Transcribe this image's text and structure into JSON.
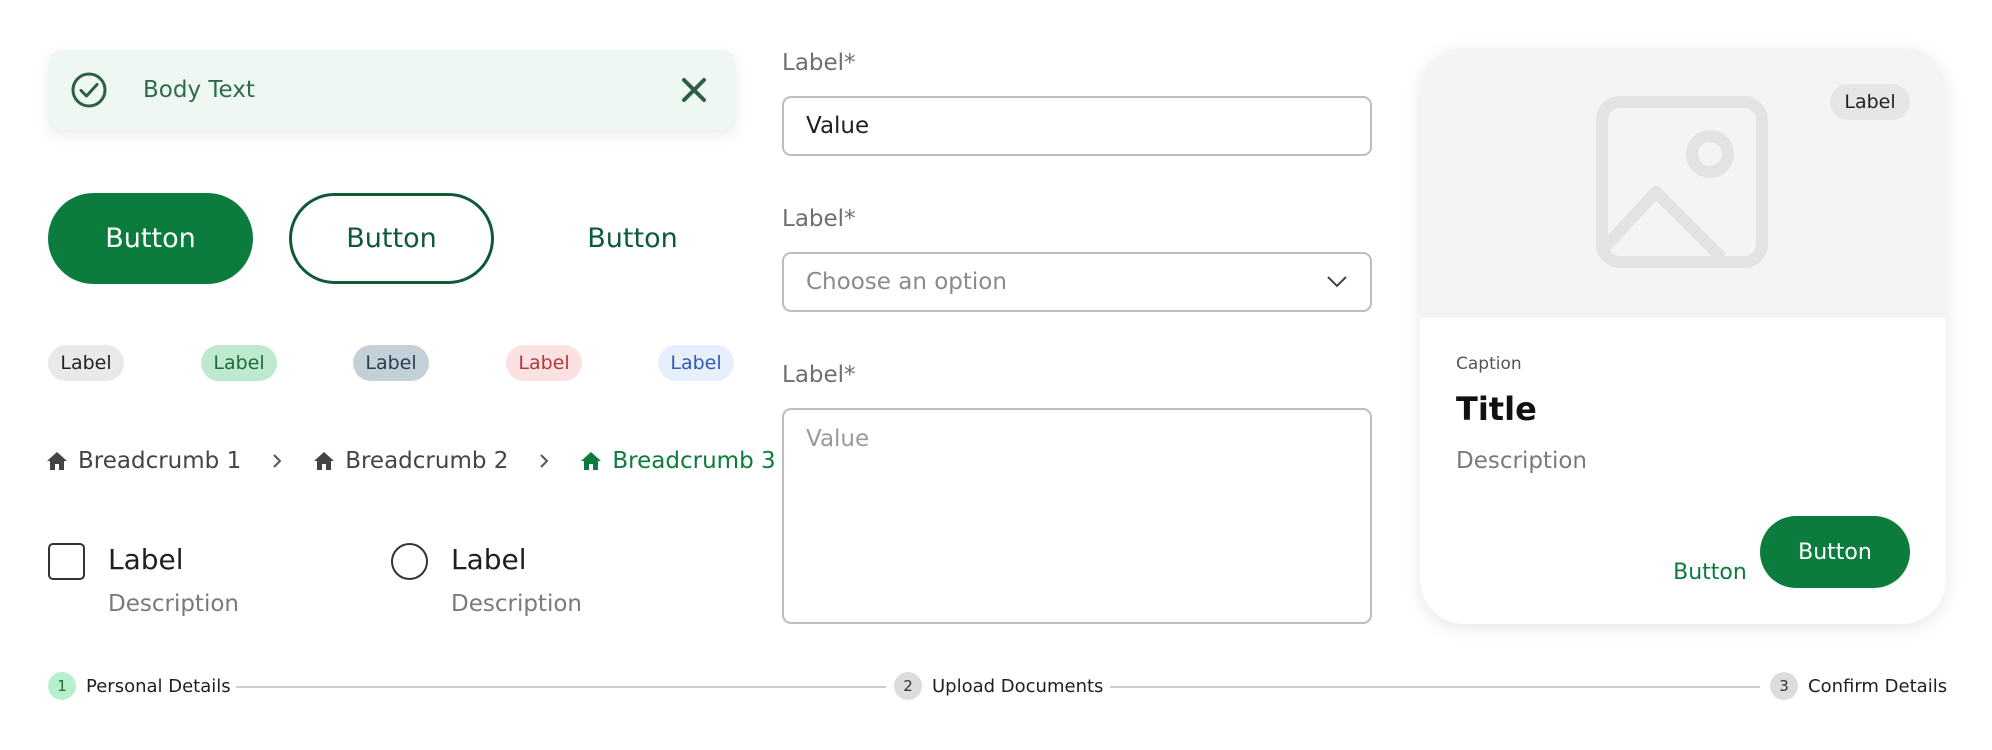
{
  "toast": {
    "text": "Body Text"
  },
  "buttons": {
    "primary": "Button",
    "outline": "Button",
    "text": "Button"
  },
  "tags": [
    "Label",
    "Label",
    "Label",
    "Label",
    "Label"
  ],
  "breadcrumbs": [
    "Breadcrumb 1",
    "Breadcrumb 2",
    "Breadcrumb 3"
  ],
  "checkbox": {
    "label": "Label",
    "description": "Description"
  },
  "radio": {
    "label": "Label",
    "description": "Description"
  },
  "form": {
    "text_field": {
      "label": "Label*",
      "value": "Value"
    },
    "select_field": {
      "label": "Label*",
      "placeholder": "Choose an option"
    },
    "textarea_field": {
      "label": "Label*",
      "placeholder": "Value"
    }
  },
  "card": {
    "tag": "Label",
    "caption": "Caption",
    "title": "Title",
    "description": "Description",
    "secondary_button": "Button",
    "primary_button": "Button"
  },
  "stepper": {
    "steps": [
      {
        "number": "1",
        "label": "Personal Details"
      },
      {
        "number": "2",
        "label": "Upload Documents"
      },
      {
        "number": "3",
        "label": "Confirm Details"
      }
    ]
  },
  "colors": {
    "brand_green": "#0c7c3e",
    "dark_green": "#0f5a36",
    "toast_bg": "#eef7f1"
  },
  "icons": {
    "toast_status": "check-circle-icon",
    "toast_close": "close-icon",
    "breadcrumb": "home-icon",
    "separator": "chevron-right-icon",
    "select": "chevron-down-icon",
    "card_media": "image-placeholder-icon"
  }
}
